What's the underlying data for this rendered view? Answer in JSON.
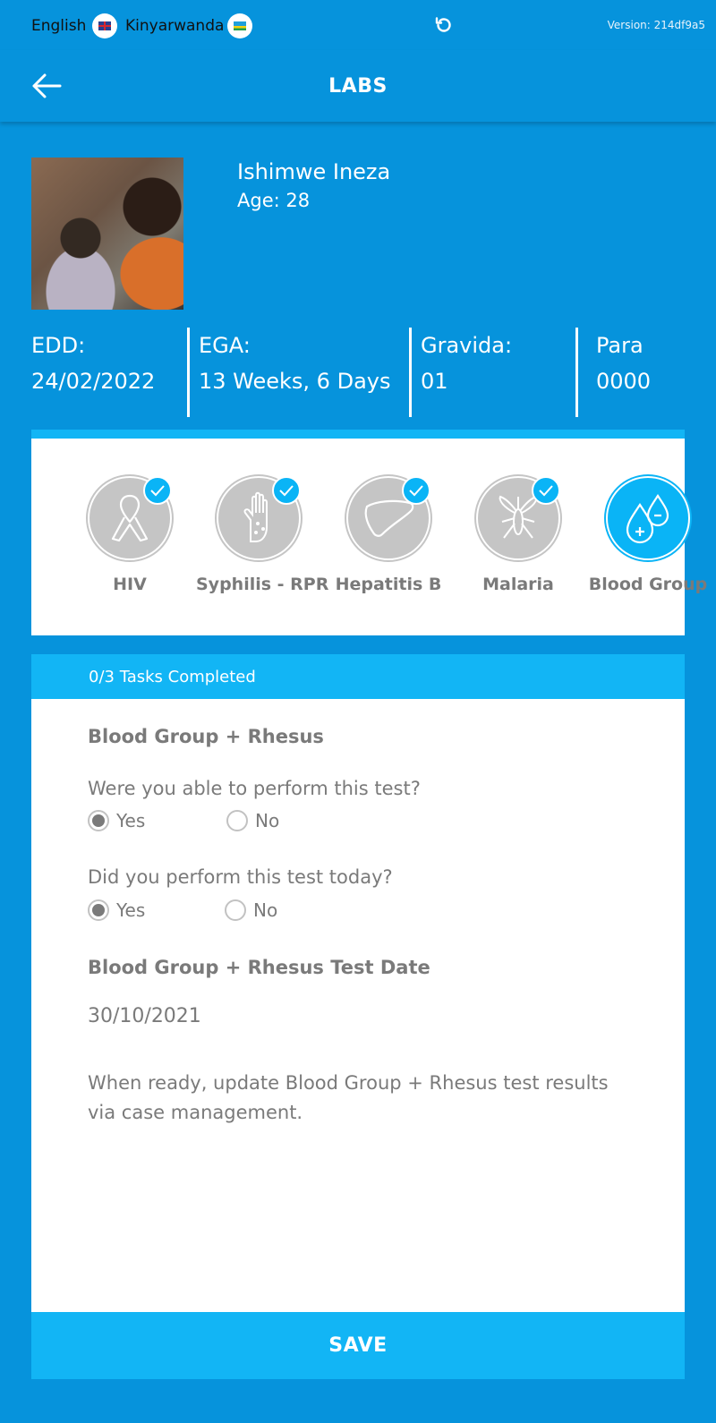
{
  "topbar": {
    "lang_en": "English",
    "lang_rw": "Kinyarwanda",
    "version": "Version: 214df9a5",
    "refresh_icon": "refresh-icon"
  },
  "header": {
    "title": "LABS",
    "back_icon": "back-arrow-icon"
  },
  "patient": {
    "name": "Ishimwe Ineza",
    "age": "Age: 28",
    "edd_label": "EDD:",
    "edd_value": "24/02/2022",
    "ega_label": "EGA:",
    "ega_value": "13 Weeks, 6 Days",
    "gravida_label": "Gravida:",
    "gravida_value": "01",
    "para_label": "Para",
    "para_value": "0000"
  },
  "tests": [
    {
      "label": "HIV",
      "icon": "ribbon-icon",
      "done": true
    },
    {
      "label": "Syphilis - RPR",
      "icon": "hand-icon",
      "done": true
    },
    {
      "label": "Hepatitis B",
      "icon": "liver-icon",
      "done": true
    },
    {
      "label": "Malaria",
      "icon": "mosquito-icon",
      "done": true
    },
    {
      "label": "Blood Group",
      "icon": "blood-drops-icon",
      "done": false
    }
  ],
  "form": {
    "progress": "0/3 Tasks Completed",
    "section_title": "Blood Group + Rhesus",
    "q1": "Were you able to perform this test?",
    "q1_yes": "Yes",
    "q1_no": "No",
    "q1_selected": "Yes",
    "q2": "Did you perform this test today?",
    "q2_yes": "Yes",
    "q2_no": "No",
    "q2_selected": "Yes",
    "date_label": "Blood Group + Rhesus Test Date",
    "date_value": "30/10/2021",
    "note": "When ready, update Blood Group + Rhesus test results via case management.",
    "save_label": "SAVE"
  },
  "colors": {
    "primary": "#0693dc",
    "accent": "#12b5f5",
    "muted": "#7a7a7a",
    "inactive": "#c5c5c5"
  }
}
